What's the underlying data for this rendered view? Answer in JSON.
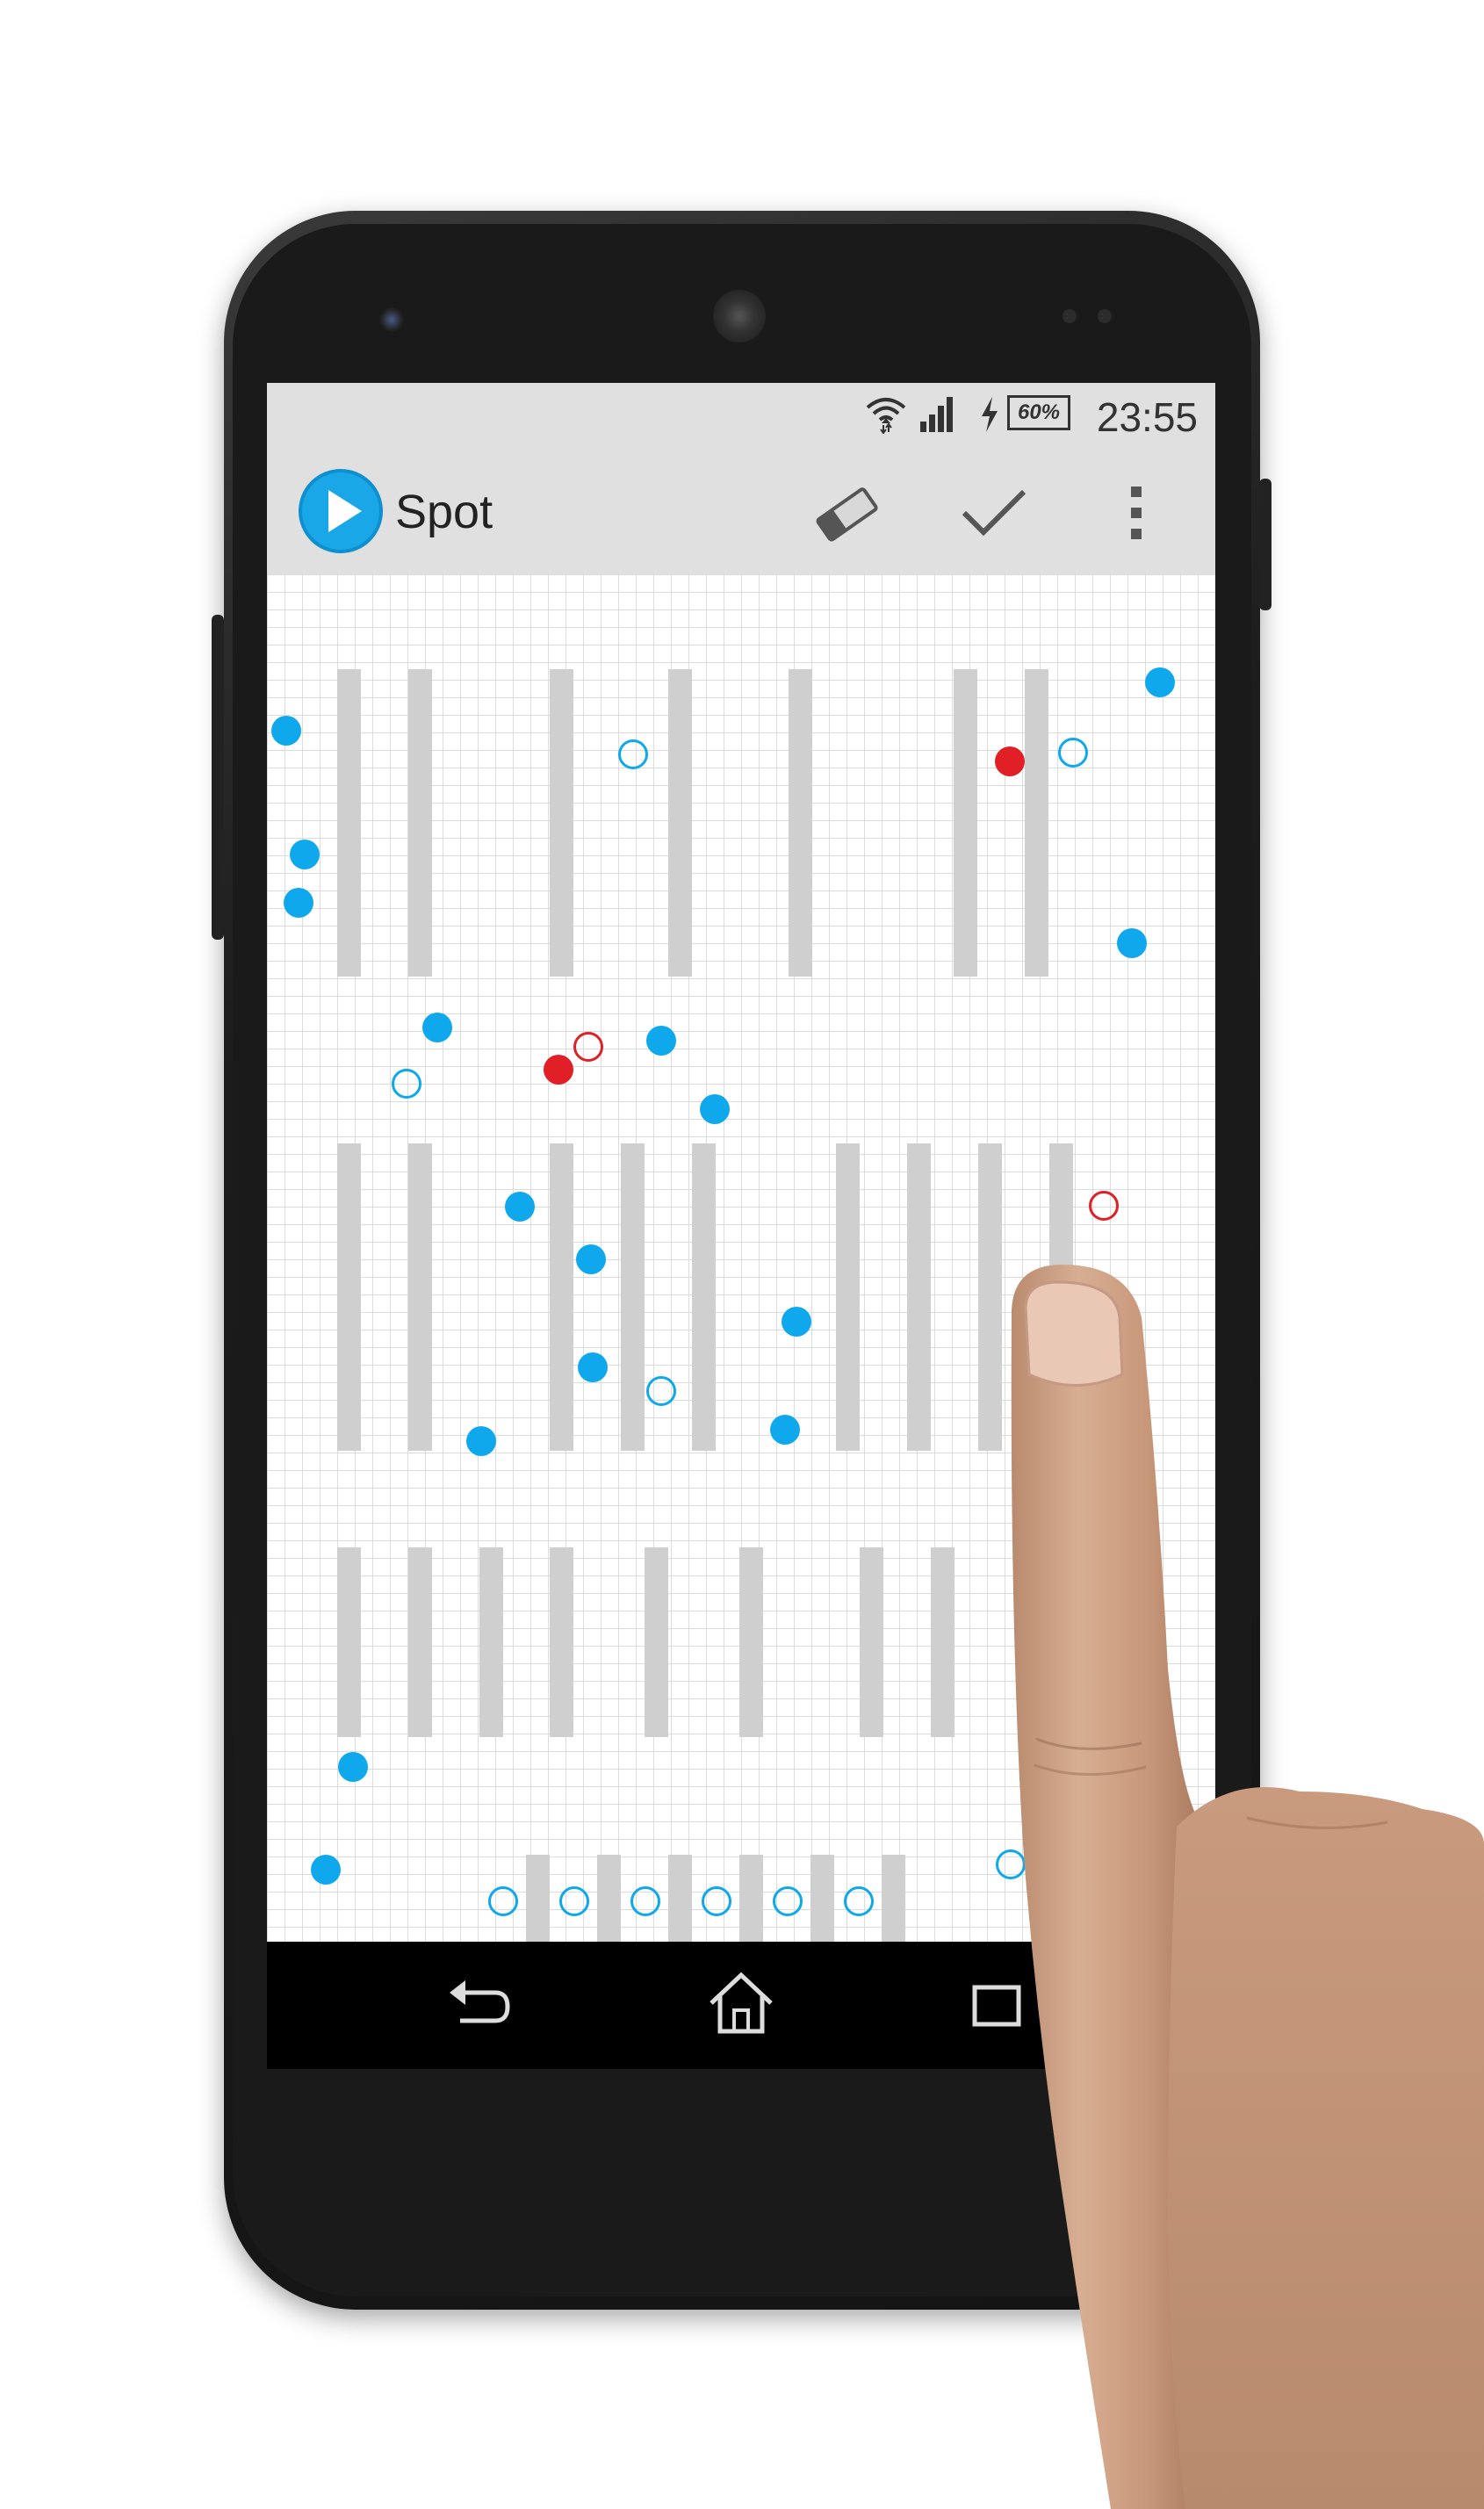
{
  "statusbar": {
    "battery": "60%",
    "time": "23:55"
  },
  "actionbar": {
    "title": "Spot",
    "icons": [
      "app-logo-icon",
      "eraser-icon",
      "check-icon",
      "overflow-menu-icon"
    ]
  },
  "navbar": {
    "icons": [
      "back-icon",
      "home-icon",
      "recents-icon"
    ]
  },
  "colors": {
    "accent": "#10a8ec",
    "marker_red": "#e01f26",
    "bar": "#cfcfcf",
    "grid": "#dcdcdc",
    "chrome": "#e0e0e0"
  }
}
